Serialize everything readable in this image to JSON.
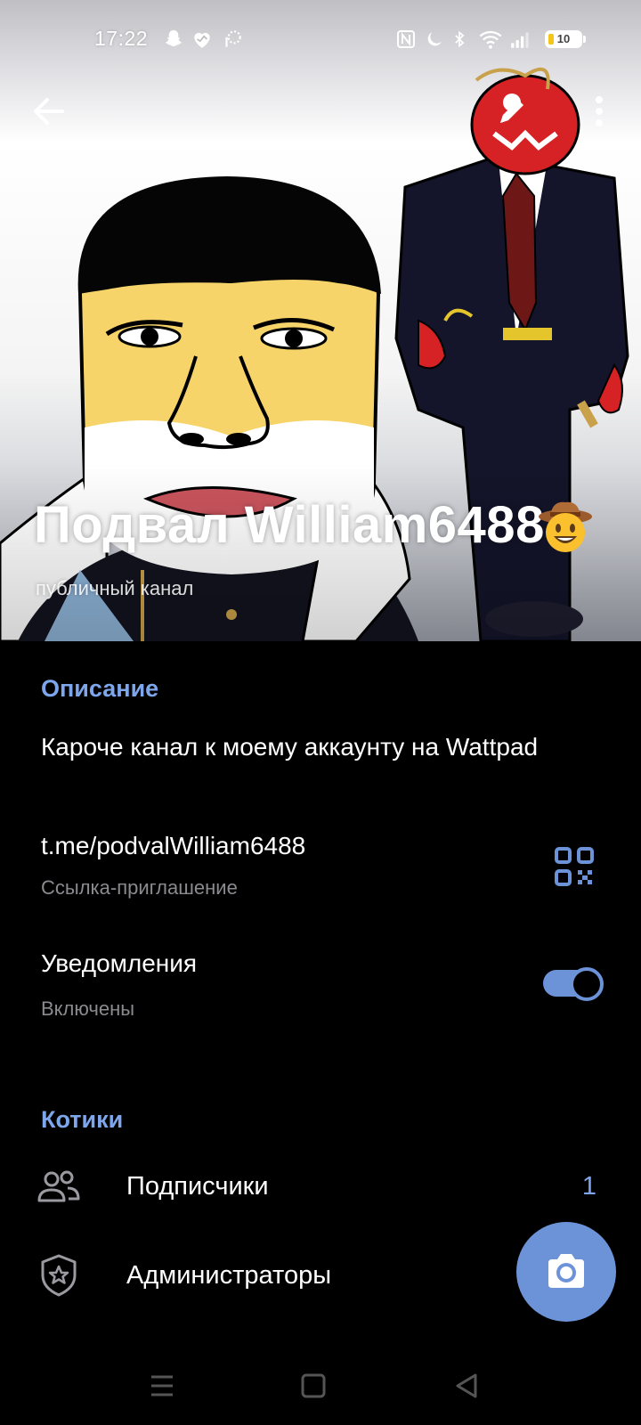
{
  "status_bar": {
    "time": "17:22",
    "battery_level": "10",
    "icons": [
      "snapchat-icon",
      "heart-icon",
      "pinwheel-icon",
      "nfc-icon",
      "moon-icon",
      "bluetooth-icon",
      "wifi-icon",
      "signal-icon",
      "battery-icon"
    ]
  },
  "header": {
    "title": "Подвал William6488",
    "title_emoji": "cowboy-emoji",
    "subtitle": "публичный канал",
    "back_icon": "arrow-left-icon",
    "edit_icon": "pencil-icon",
    "more_icon": "more-vertical-icon"
  },
  "info": {
    "description_header": "Описание",
    "description": "Кароче канал к моему аккаунту на Wattpad",
    "link": "t.me/podvalWilliam6488",
    "link_caption": "Ссылка-приглашение",
    "qr_icon": "qr-code-icon",
    "notifications_title": "Уведомления",
    "notifications_state": "Включены",
    "notifications_on": true
  },
  "members": {
    "header": "Котики",
    "subscribers_label": "Подписчики",
    "subscribers_count": "1",
    "admins_label": "Администраторы"
  },
  "fab": {
    "icon": "camera-icon"
  },
  "colors": {
    "accent": "#7ea6ec",
    "fab": "#6c93d8",
    "background": "#000000",
    "secondary_text": "#8a8a8f"
  },
  "nav_bar": {
    "items": [
      "menu-icon",
      "home-square-icon",
      "back-triangle-icon"
    ]
  }
}
